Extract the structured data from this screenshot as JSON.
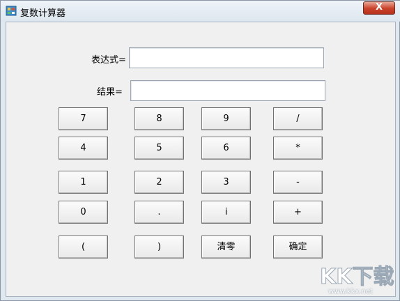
{
  "window": {
    "title": "复数计算器",
    "close_label": "X"
  },
  "form": {
    "expression_label": "表达式=",
    "expression_value": "",
    "result_label": "结果=",
    "result_value": ""
  },
  "keypad": {
    "rows": [
      [
        "7",
        "8",
        "9",
        "/"
      ],
      [
        "4",
        "5",
        "6",
        "*"
      ],
      [
        "1",
        "2",
        "3",
        "-"
      ],
      [
        "0",
        ".",
        "i",
        "+"
      ],
      [
        "(",
        ")",
        "清零",
        "确定"
      ]
    ]
  },
  "watermark": {
    "logo_text": "KK下载",
    "url": "www.kkx.net"
  }
}
